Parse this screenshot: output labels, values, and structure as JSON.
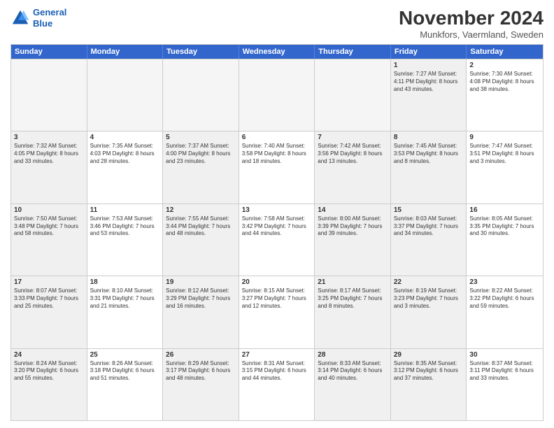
{
  "logo": {
    "line1": "General",
    "line2": "Blue"
  },
  "title": "November 2024",
  "subtitle": "Munkfors, Vaermland, Sweden",
  "headers": [
    "Sunday",
    "Monday",
    "Tuesday",
    "Wednesday",
    "Thursday",
    "Friday",
    "Saturday"
  ],
  "weeks": [
    [
      {
        "day": "",
        "info": "",
        "empty": true
      },
      {
        "day": "",
        "info": "",
        "empty": true
      },
      {
        "day": "",
        "info": "",
        "empty": true
      },
      {
        "day": "",
        "info": "",
        "empty": true
      },
      {
        "day": "",
        "info": "",
        "empty": true
      },
      {
        "day": "1",
        "info": "Sunrise: 7:27 AM\nSunset: 4:11 PM\nDaylight: 8 hours\nand 43 minutes.",
        "shaded": true
      },
      {
        "day": "2",
        "info": "Sunrise: 7:30 AM\nSunset: 4:08 PM\nDaylight: 8 hours\nand 38 minutes.",
        "shaded": false
      }
    ],
    [
      {
        "day": "3",
        "info": "Sunrise: 7:32 AM\nSunset: 4:05 PM\nDaylight: 8 hours\nand 33 minutes.",
        "shaded": true
      },
      {
        "day": "4",
        "info": "Sunrise: 7:35 AM\nSunset: 4:03 PM\nDaylight: 8 hours\nand 28 minutes.",
        "shaded": false
      },
      {
        "day": "5",
        "info": "Sunrise: 7:37 AM\nSunset: 4:00 PM\nDaylight: 8 hours\nand 23 minutes.",
        "shaded": true
      },
      {
        "day": "6",
        "info": "Sunrise: 7:40 AM\nSunset: 3:58 PM\nDaylight: 8 hours\nand 18 minutes.",
        "shaded": false
      },
      {
        "day": "7",
        "info": "Sunrise: 7:42 AM\nSunset: 3:56 PM\nDaylight: 8 hours\nand 13 minutes.",
        "shaded": true
      },
      {
        "day": "8",
        "info": "Sunrise: 7:45 AM\nSunset: 3:53 PM\nDaylight: 8 hours\nand 8 minutes.",
        "shaded": true
      },
      {
        "day": "9",
        "info": "Sunrise: 7:47 AM\nSunset: 3:51 PM\nDaylight: 8 hours\nand 3 minutes.",
        "shaded": false
      }
    ],
    [
      {
        "day": "10",
        "info": "Sunrise: 7:50 AM\nSunset: 3:48 PM\nDaylight: 7 hours\nand 58 minutes.",
        "shaded": true
      },
      {
        "day": "11",
        "info": "Sunrise: 7:53 AM\nSunset: 3:46 PM\nDaylight: 7 hours\nand 53 minutes.",
        "shaded": false
      },
      {
        "day": "12",
        "info": "Sunrise: 7:55 AM\nSunset: 3:44 PM\nDaylight: 7 hours\nand 48 minutes.",
        "shaded": true
      },
      {
        "day": "13",
        "info": "Sunrise: 7:58 AM\nSunset: 3:42 PM\nDaylight: 7 hours\nand 44 minutes.",
        "shaded": false
      },
      {
        "day": "14",
        "info": "Sunrise: 8:00 AM\nSunset: 3:39 PM\nDaylight: 7 hours\nand 39 minutes.",
        "shaded": true
      },
      {
        "day": "15",
        "info": "Sunrise: 8:03 AM\nSunset: 3:37 PM\nDaylight: 7 hours\nand 34 minutes.",
        "shaded": true
      },
      {
        "day": "16",
        "info": "Sunrise: 8:05 AM\nSunset: 3:35 PM\nDaylight: 7 hours\nand 30 minutes.",
        "shaded": false
      }
    ],
    [
      {
        "day": "17",
        "info": "Sunrise: 8:07 AM\nSunset: 3:33 PM\nDaylight: 7 hours\nand 25 minutes.",
        "shaded": true
      },
      {
        "day": "18",
        "info": "Sunrise: 8:10 AM\nSunset: 3:31 PM\nDaylight: 7 hours\nand 21 minutes.",
        "shaded": false
      },
      {
        "day": "19",
        "info": "Sunrise: 8:12 AM\nSunset: 3:29 PM\nDaylight: 7 hours\nand 16 minutes.",
        "shaded": true
      },
      {
        "day": "20",
        "info": "Sunrise: 8:15 AM\nSunset: 3:27 PM\nDaylight: 7 hours\nand 12 minutes.",
        "shaded": false
      },
      {
        "day": "21",
        "info": "Sunrise: 8:17 AM\nSunset: 3:25 PM\nDaylight: 7 hours\nand 8 minutes.",
        "shaded": true
      },
      {
        "day": "22",
        "info": "Sunrise: 8:19 AM\nSunset: 3:23 PM\nDaylight: 7 hours\nand 3 minutes.",
        "shaded": true
      },
      {
        "day": "23",
        "info": "Sunrise: 8:22 AM\nSunset: 3:22 PM\nDaylight: 6 hours\nand 59 minutes.",
        "shaded": false
      }
    ],
    [
      {
        "day": "24",
        "info": "Sunrise: 8:24 AM\nSunset: 3:20 PM\nDaylight: 6 hours\nand 55 minutes.",
        "shaded": true
      },
      {
        "day": "25",
        "info": "Sunrise: 8:26 AM\nSunset: 3:18 PM\nDaylight: 6 hours\nand 51 minutes.",
        "shaded": false
      },
      {
        "day": "26",
        "info": "Sunrise: 8:29 AM\nSunset: 3:17 PM\nDaylight: 6 hours\nand 48 minutes.",
        "shaded": true
      },
      {
        "day": "27",
        "info": "Sunrise: 8:31 AM\nSunset: 3:15 PM\nDaylight: 6 hours\nand 44 minutes.",
        "shaded": false
      },
      {
        "day": "28",
        "info": "Sunrise: 8:33 AM\nSunset: 3:14 PM\nDaylight: 6 hours\nand 40 minutes.",
        "shaded": true
      },
      {
        "day": "29",
        "info": "Sunrise: 8:35 AM\nSunset: 3:12 PM\nDaylight: 6 hours\nand 37 minutes.",
        "shaded": true
      },
      {
        "day": "30",
        "info": "Sunrise: 8:37 AM\nSunset: 3:11 PM\nDaylight: 6 hours\nand 33 minutes.",
        "shaded": false
      }
    ]
  ]
}
